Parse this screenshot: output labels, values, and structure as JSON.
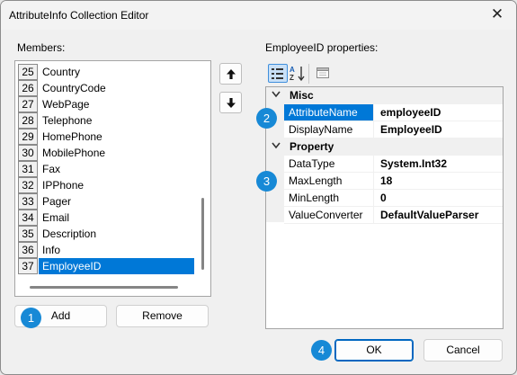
{
  "window": {
    "title": "AttributeInfo Collection Editor",
    "close_glyph": "✕"
  },
  "members": {
    "label": "Members:",
    "items": [
      {
        "index": "25",
        "name": "Country"
      },
      {
        "index": "26",
        "name": "CountryCode"
      },
      {
        "index": "27",
        "name": "WebPage"
      },
      {
        "index": "28",
        "name": "Telephone"
      },
      {
        "index": "29",
        "name": "HomePhone"
      },
      {
        "index": "30",
        "name": "MobilePhone"
      },
      {
        "index": "31",
        "name": "Fax"
      },
      {
        "index": "32",
        "name": "IPPhone"
      },
      {
        "index": "33",
        "name": "Pager"
      },
      {
        "index": "34",
        "name": "Email"
      },
      {
        "index": "35",
        "name": "Description"
      },
      {
        "index": "36",
        "name": "Info"
      },
      {
        "index": "37",
        "name": "EmployeeID"
      }
    ],
    "selected_index": 12
  },
  "move_buttons": {
    "up_icon": "arrow-up-icon",
    "down_icon": "arrow-down-icon"
  },
  "properties": {
    "label": "EmployeeID properties:",
    "toolbar": {
      "categorized_icon": "categorized-icon",
      "alphabetical_icon": "sort-alphabetical-icon",
      "pages_icon": "property-pages-icon"
    },
    "categories": [
      {
        "name": "Misc",
        "rows": [
          {
            "name": "AttributeName",
            "value": "employeeID"
          },
          {
            "name": "DisplayName",
            "value": "EmployeeID"
          }
        ]
      },
      {
        "name": "Property",
        "rows": [
          {
            "name": "DataType",
            "value": "System.Int32"
          },
          {
            "name": "MaxLength",
            "value": "18"
          },
          {
            "name": "MinLength",
            "value": "0"
          },
          {
            "name": "ValueConverter",
            "value": "DefaultValueParser"
          }
        ]
      }
    ],
    "selected_row": "AttributeName",
    "chevron": "❯"
  },
  "buttons": {
    "add": "Add",
    "remove": "Remove",
    "ok": "OK",
    "cancel": "Cancel"
  },
  "badges": [
    "1",
    "2",
    "3",
    "4"
  ],
  "colors": {
    "selection": "#0078d7",
    "badge": "#1789d6",
    "primary_border": "#0067c0"
  }
}
